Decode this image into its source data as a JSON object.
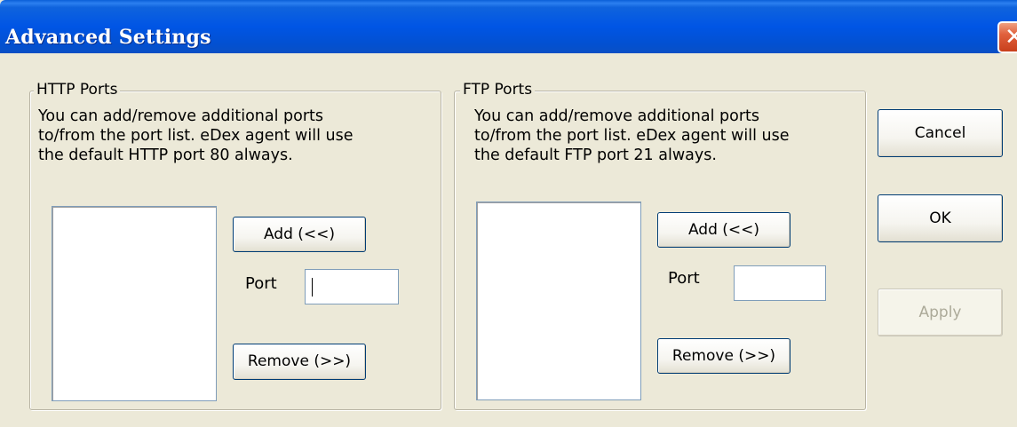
{
  "window": {
    "title": "Advanced Settings"
  },
  "http_group": {
    "legend": "HTTP Ports",
    "description": "You can add/remove additional ports\nto/from the port list. eDex agent will use\nthe default HTTP port 80 always.",
    "add_label": "Add (<<)",
    "port_label": "Port",
    "port_value": "",
    "remove_label": "Remove (>>)"
  },
  "ftp_group": {
    "legend": "FTP Ports",
    "description": "You can add/remove additional ports\nto/from the port list. eDex agent will use\nthe default FTP port 21 always.",
    "add_label": "Add (<<)",
    "port_label": "Port",
    "port_value": "",
    "remove_label": "Remove (>>)"
  },
  "buttons": {
    "cancel_label": "Cancel",
    "ok_label": "OK",
    "apply_label": "Apply"
  }
}
